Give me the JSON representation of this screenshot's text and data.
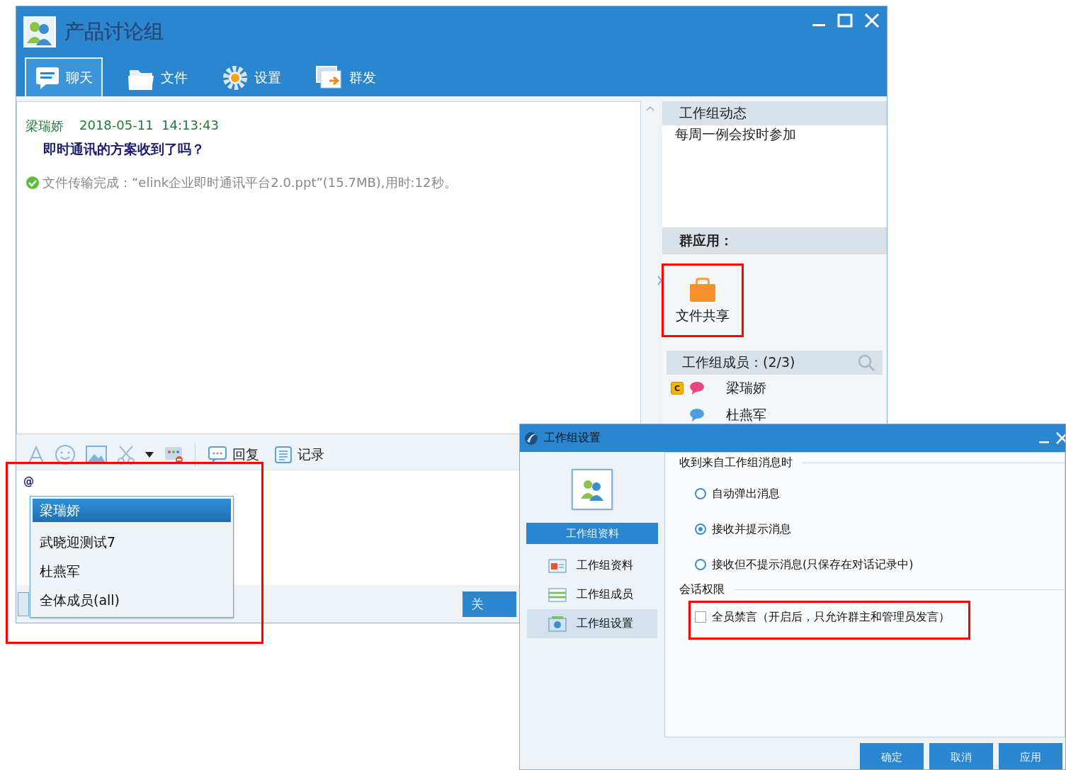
{
  "main_window": {
    "title": "产品讨论组",
    "tabs": [
      {
        "label": "聊天",
        "selected": true,
        "kind": "chat"
      },
      {
        "label": "文件",
        "selected": false,
        "kind": "file"
      },
      {
        "label": "设置",
        "selected": false,
        "kind": "settings"
      },
      {
        "label": "群发",
        "selected": false,
        "kind": "broadcast"
      }
    ],
    "chat": {
      "messages": [
        {
          "sender": "梁瑞娇",
          "time": "2018-05-11  14:13:43",
          "text": "即时通讯的方案收到了吗？"
        }
      ],
      "notice": "文件传输完成：“elink企业即时通讯平台2.0.ppt”(15.7MB),用时:12秒。"
    },
    "right_panel": {
      "news_title": "工作组动态",
      "news_text": "每周一例会按时参加",
      "apps_title": "群应用：",
      "apps": [
        {
          "label": "文件共享",
          "highlighted": true
        }
      ],
      "members_title": "工作组成员：(2/3)",
      "members": [
        {
          "name": "梁瑞娇",
          "badge": "C",
          "color": "#e8467c"
        },
        {
          "name": "杜燕军",
          "color": "#4a9fe0"
        }
      ]
    },
    "toolbar": {
      "actions": [
        {
          "label": "回复",
          "kind": "reply"
        },
        {
          "label": "记录",
          "kind": "history"
        }
      ]
    },
    "input": {
      "value": "@"
    },
    "mention_popup": {
      "highlighted": true,
      "items": [
        {
          "label": "梁瑞娇",
          "selected": true
        },
        {
          "label": "武晓迎测试7",
          "selected": false
        },
        {
          "label": "杜燕军",
          "selected": false
        },
        {
          "label": "全体成员(all)",
          "selected": false
        }
      ]
    },
    "close_button": "关"
  },
  "dialog": {
    "title": "工作组设置",
    "nav_header": "工作组资料",
    "nav_items": [
      {
        "label": "工作组资料",
        "selected": false,
        "kind": "profile"
      },
      {
        "label": "工作组成员",
        "selected": false,
        "kind": "members"
      },
      {
        "label": "工作组设置",
        "selected": true,
        "kind": "settings"
      }
    ],
    "message_section": "收到来自工作组消息时",
    "options": [
      {
        "label": "自动弹出消息",
        "selected": false
      },
      {
        "label": "接收并提示消息",
        "selected": true
      },
      {
        "label": "接收但不提示消息(只保存在对话记录中)",
        "selected": false
      }
    ],
    "permission_section": "会话权限",
    "mute_all": {
      "label": "全员禁言（开启后，只允许群主和管理员发言）",
      "checked": false,
      "highlighted": true
    },
    "buttons": [
      "确定",
      "取消",
      "应用"
    ]
  }
}
